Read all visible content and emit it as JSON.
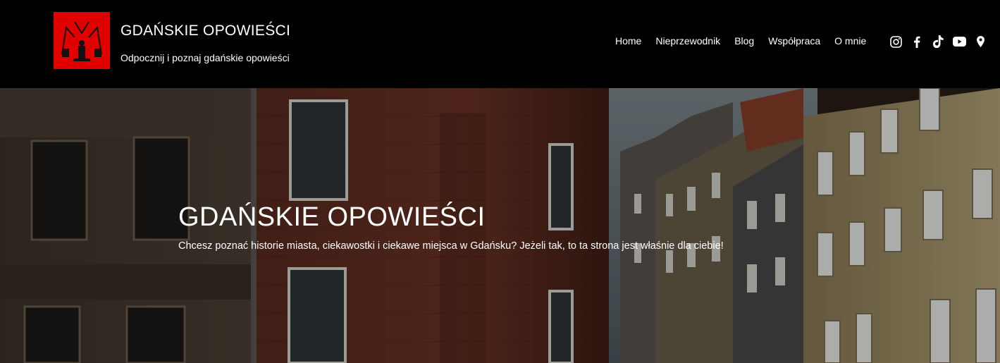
{
  "header": {
    "site_title": "GDAŃSKIE OPOWIEŚCI",
    "tagline": "Odpocznij i poznaj gdańskie opowieści",
    "logo_color": "#e00000"
  },
  "nav": {
    "items": [
      {
        "label": "Home"
      },
      {
        "label": "Nieprzewodnik"
      },
      {
        "label": "Blog"
      },
      {
        "label": "Współpraca"
      },
      {
        "label": "O mnie"
      }
    ]
  },
  "social": {
    "icons": [
      "instagram-icon",
      "facebook-icon",
      "tiktok-icon",
      "youtube-icon",
      "map-pin-icon"
    ]
  },
  "hero": {
    "title": "GDAŃSKIE OPOWIEŚCI",
    "text": "Chcesz poznać historie miasta, ciekawostki i ciekawe miejsca w Gdańsku? Jeżeli tak, to ta strona jest właśnie dla ciebie!"
  }
}
